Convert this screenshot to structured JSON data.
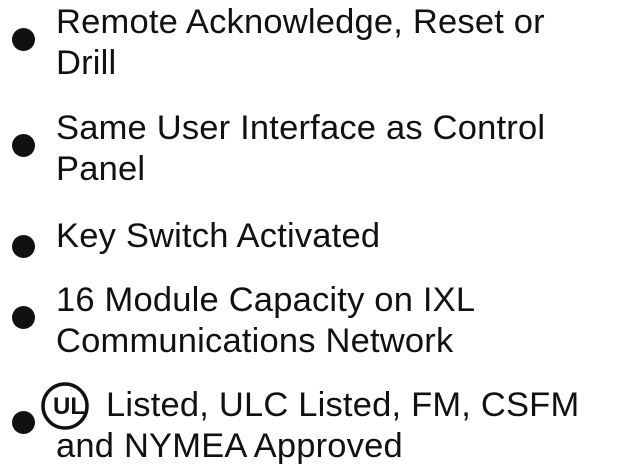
{
  "features": [
    {
      "line1": "Remote Acknowledge, Reset or",
      "line2": "Drill"
    },
    {
      "line1": "Same User Interface as Control",
      "line2": "Panel"
    },
    {
      "line1": "Key Switch Activated",
      "line2": ""
    },
    {
      "line1": "16 Module Capacity on IXL",
      "line2": "Communications Network"
    },
    {
      "line1": "Listed, ULC Listed, FM, CSFM",
      "line2": "and NYMEA Approved"
    }
  ],
  "listing_mark": {
    "icon": "ul-listed-logo",
    "text": "UL"
  }
}
